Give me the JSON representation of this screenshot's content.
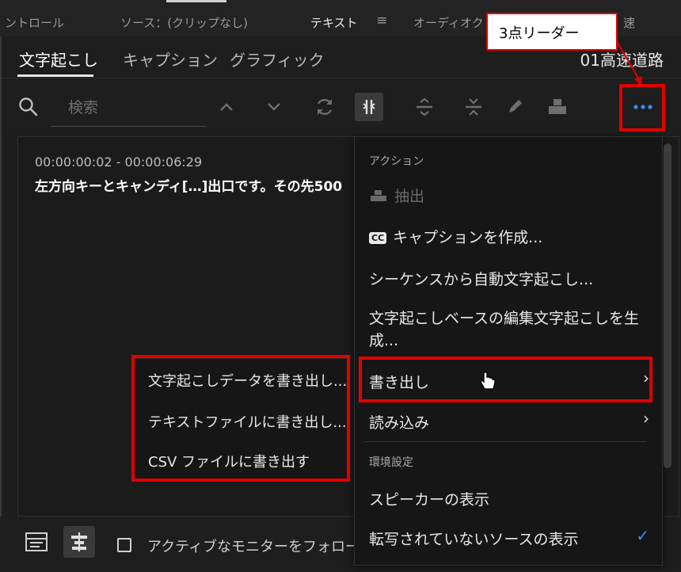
{
  "panel_tabs": [
    "ントロール",
    "ソース：(クリップなし)",
    "テキスト",
    "オーディオク",
    "速"
  ],
  "sub_tabs": [
    "文字起こし",
    "キャプション",
    "グラフィック"
  ],
  "sequence_name": "01高速道路",
  "search": {
    "placeholder": "検索"
  },
  "transcript": {
    "timecode": "00:00:00:02 - 00:00:06:29",
    "text": "左方向キーとキャンディ[…]出口です。その先500"
  },
  "menu": {
    "header_action": "アクション",
    "extract": "抽出",
    "create_captions": "キャプションを作成...",
    "cc_badge": "CC",
    "auto_transcribe": "シーケンスから自動文字起こし...",
    "generate_line1": "文字起こしベースの編集文字起こしを生",
    "generate_line2": "成...",
    "export": "書き出し",
    "import": "読み込み",
    "header_prefs": "環境設定",
    "show_speakers": "スピーカーの表示",
    "show_untranscribed": "転写されていないソースの表示"
  },
  "submenu": {
    "export_transcript": "文字起こしデータを書き出し...",
    "export_text": "テキストファイルに書き出し...",
    "export_csv": "CSV ファイルに書き出す"
  },
  "bottom": {
    "follow_monitor": "アクティブなモニターをフォロー"
  },
  "annotation": {
    "callout": "3点リーダー"
  },
  "colors": {
    "accent_blue": "#3d8ef0",
    "annotation_red": "#e00000"
  },
  "icons": [
    "search-icon",
    "chevron-up-icon",
    "chevron-down-icon",
    "refresh-icon",
    "split-icon",
    "merge-icon",
    "unmerge-icon",
    "pencil-icon",
    "extract-icon",
    "more-icon",
    "cursor-hand-icon",
    "checkmark-icon"
  ]
}
